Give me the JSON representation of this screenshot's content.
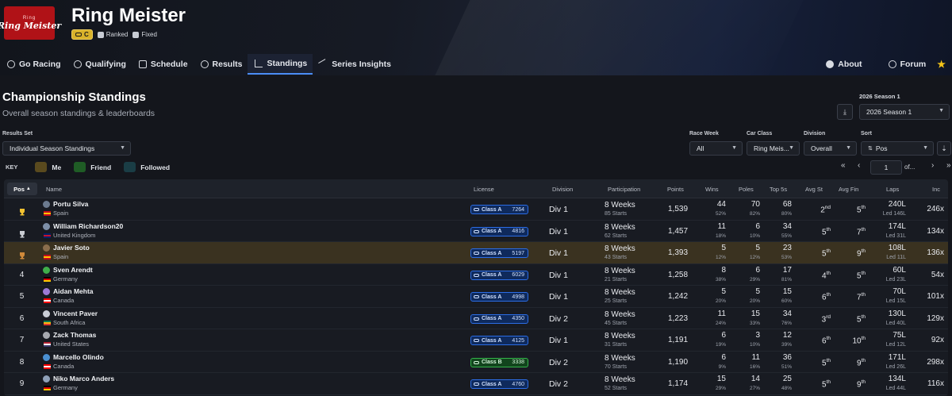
{
  "app": {
    "logo_small": "Ring",
    "logo_text": "Ring Meister",
    "title": "Ring Meister",
    "license_chip": "C",
    "tags": [
      "Ranked",
      "Fixed"
    ]
  },
  "nav": {
    "items": [
      "Go Racing",
      "Qualifying",
      "Schedule",
      "Results",
      "Standings",
      "Series Insights"
    ],
    "active": "Standings",
    "right": [
      "About",
      "Forum"
    ]
  },
  "page": {
    "title": "Championship Standings",
    "subtitle": "Overall season standings & leaderboards"
  },
  "season": {
    "label": "2026 Season 1",
    "value": "2026 Season 1"
  },
  "filters": {
    "results_set_label": "Results Set",
    "results_set_value": "Individual Season Standings",
    "race_week_label": "Race Week",
    "race_week_value": "All",
    "car_class_label": "Car Class",
    "car_class_value": "Ring Meis...",
    "division_label": "Division",
    "division_value": "Overall",
    "sort_label": "Sort",
    "sort_value": "Pos"
  },
  "legend": {
    "key_label": "KEY",
    "items": [
      {
        "label": "Me",
        "color": "#5a4a1e"
      },
      {
        "label": "Friend",
        "color": "#1f5c25"
      },
      {
        "label": "Followed",
        "color": "#1a3d45"
      }
    ]
  },
  "pager": {
    "page": "1",
    "of": "of..."
  },
  "table": {
    "headers": {
      "pos": "Pos",
      "name": "Name",
      "license": "License",
      "division": "Division",
      "participation": "Participation",
      "points": "Points",
      "wins": "Wins",
      "poles": "Poles",
      "top5": "Top 5s",
      "avg_st": "Avg St",
      "avg_fin": "Avg Fin",
      "laps": "Laps",
      "inc": "Inc"
    },
    "rows": [
      {
        "pos": "1",
        "trophy": "gold",
        "name": "Portu Silva",
        "country": "Spain",
        "lic_class": "A",
        "lic_label": "Class A",
        "sr": "7264",
        "division": "Div 1",
        "weeks": "8 Weeks",
        "starts": "85 Starts",
        "points": "1,539",
        "wins": "44",
        "wins_pct": "52%",
        "poles": "70",
        "poles_pct": "82%",
        "top5": "68",
        "top5_pct": "80%",
        "avg_st": "2",
        "avg_st_sfx": "nd",
        "avg_fin": "5",
        "avg_fin_sfx": "th",
        "laps": "240L",
        "led": "Led 146L",
        "inc": "246x",
        "me": false,
        "avatar": "#6b7a8f",
        "flag": "es"
      },
      {
        "pos": "2",
        "trophy": "silver",
        "name": "William Richardson20",
        "country": "United Kingdom",
        "lic_class": "A",
        "lic_label": "Class A",
        "sr": "4816",
        "division": "Div 1",
        "weeks": "8 Weeks",
        "starts": "62 Starts",
        "points": "1,457",
        "wins": "11",
        "wins_pct": "18%",
        "poles": "6",
        "poles_pct": "10%",
        "top5": "34",
        "top5_pct": "55%",
        "avg_st": "5",
        "avg_st_sfx": "th",
        "avg_fin": "7",
        "avg_fin_sfx": "th",
        "laps": "174L",
        "led": "Led 31L",
        "inc": "134x",
        "me": false,
        "avatar": "#7d8fa8",
        "flag": "gb"
      },
      {
        "pos": "3",
        "trophy": "bronze",
        "name": "Javier Soto",
        "country": "Spain",
        "lic_class": "A",
        "lic_label": "Class A",
        "sr": "5197",
        "division": "Div 1",
        "weeks": "8 Weeks",
        "starts": "43 Starts",
        "points": "1,393",
        "wins": "5",
        "wins_pct": "12%",
        "poles": "5",
        "poles_pct": "12%",
        "top5": "23",
        "top5_pct": "53%",
        "avg_st": "5",
        "avg_st_sfx": "th",
        "avg_fin": "9",
        "avg_fin_sfx": "th",
        "laps": "108L",
        "led": "Led 11L",
        "inc": "136x",
        "me": true,
        "avatar": "#8a6d4c",
        "flag": "es"
      },
      {
        "pos": "4",
        "trophy": "",
        "name": "Sven Arendt",
        "country": "Germany",
        "lic_class": "A",
        "lic_label": "Class A",
        "sr": "6029",
        "division": "Div 1",
        "weeks": "8 Weeks",
        "starts": "21 Starts",
        "points": "1,258",
        "wins": "8",
        "wins_pct": "38%",
        "poles": "6",
        "poles_pct": "29%",
        "top5": "17",
        "top5_pct": "81%",
        "avg_st": "4",
        "avg_st_sfx": "th",
        "avg_fin": "5",
        "avg_fin_sfx": "th",
        "laps": "60L",
        "led": "Led 23L",
        "inc": "54x",
        "me": false,
        "avatar": "#3fae4a",
        "flag": "de"
      },
      {
        "pos": "5",
        "trophy": "",
        "name": "Aidan Mehta",
        "country": "Canada",
        "lic_class": "A",
        "lic_label": "Class A",
        "sr": "4998",
        "division": "Div 1",
        "weeks": "8 Weeks",
        "starts": "25 Starts",
        "points": "1,242",
        "wins": "5",
        "wins_pct": "20%",
        "poles": "5",
        "poles_pct": "20%",
        "top5": "15",
        "top5_pct": "60%",
        "avg_st": "6",
        "avg_st_sfx": "th",
        "avg_fin": "7",
        "avg_fin_sfx": "th",
        "laps": "70L",
        "led": "Led 15L",
        "inc": "101x",
        "me": false,
        "avatar": "#9b7ad6",
        "flag": "ca"
      },
      {
        "pos": "6",
        "trophy": "",
        "name": "Vincent Paver",
        "country": "South Africa",
        "lic_class": "A",
        "lic_label": "Class A",
        "sr": "4350",
        "division": "Div 2",
        "weeks": "8 Weeks",
        "starts": "45 Starts",
        "points": "1,223",
        "wins": "11",
        "wins_pct": "24%",
        "poles": "15",
        "poles_pct": "33%",
        "top5": "34",
        "top5_pct": "76%",
        "avg_st": "3",
        "avg_st_sfx": "rd",
        "avg_fin": "5",
        "avg_fin_sfx": "th",
        "laps": "130L",
        "led": "Led 40L",
        "inc": "129x",
        "me": false,
        "avatar": "#c9cdd6",
        "flag": "za"
      },
      {
        "pos": "7",
        "trophy": "",
        "name": "Zack Thomas",
        "country": "United States",
        "lic_class": "A",
        "lic_label": "Class A",
        "sr": "4125",
        "division": "Div 1",
        "weeks": "8 Weeks",
        "starts": "31 Starts",
        "points": "1,191",
        "wins": "6",
        "wins_pct": "19%",
        "poles": "3",
        "poles_pct": "10%",
        "top5": "12",
        "top5_pct": "39%",
        "avg_st": "6",
        "avg_st_sfx": "th",
        "avg_fin": "10",
        "avg_fin_sfx": "th",
        "laps": "75L",
        "led": "Led 12L",
        "inc": "92x",
        "me": false,
        "avatar": "#a6a9b0",
        "flag": "us"
      },
      {
        "pos": "8",
        "trophy": "",
        "name": "Marcello Olindo",
        "country": "Canada",
        "lic_class": "B",
        "lic_label": "Class B",
        "sr": "3338",
        "division": "Div 2",
        "weeks": "8 Weeks",
        "starts": "70 Starts",
        "points": "1,190",
        "wins": "6",
        "wins_pct": "9%",
        "poles": "11",
        "poles_pct": "16%",
        "top5": "36",
        "top5_pct": "51%",
        "avg_st": "5",
        "avg_st_sfx": "th",
        "avg_fin": "9",
        "avg_fin_sfx": "th",
        "laps": "171L",
        "led": "Led 26L",
        "inc": "298x",
        "me": false,
        "avatar": "#4a8fd1",
        "flag": "ca"
      },
      {
        "pos": "9",
        "trophy": "",
        "name": "Niko Marco Anders",
        "country": "Germany",
        "lic_class": "A",
        "lic_label": "Class A",
        "sr": "4760",
        "division": "Div 2",
        "weeks": "8 Weeks",
        "starts": "52 Starts",
        "points": "1,174",
        "wins": "15",
        "wins_pct": "29%",
        "poles": "14",
        "poles_pct": "27%",
        "top5": "25",
        "top5_pct": "48%",
        "avg_st": "5",
        "avg_st_sfx": "th",
        "avg_fin": "9",
        "avg_fin_sfx": "th",
        "laps": "134L",
        "led": "Led 44L",
        "inc": "116x",
        "me": false,
        "avatar": "#8fa0b8",
        "flag": "de"
      }
    ]
  }
}
